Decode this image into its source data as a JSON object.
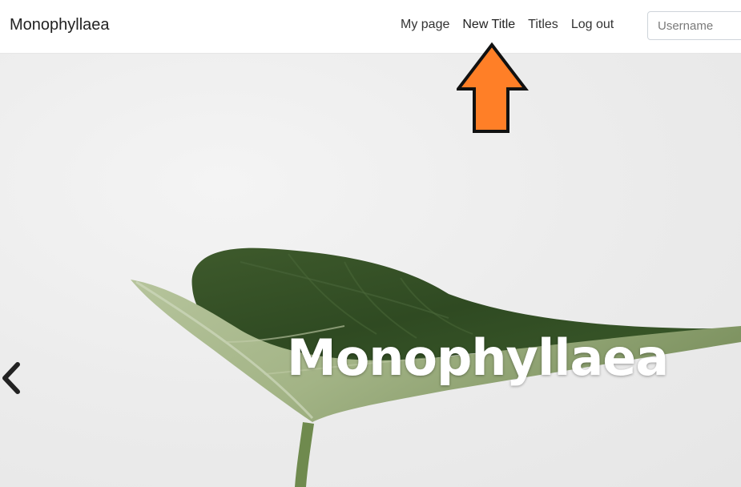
{
  "navbar": {
    "brand": "Monophyllaea",
    "links": [
      {
        "label": "My page"
      },
      {
        "label": "New Title"
      },
      {
        "label": "Titles"
      },
      {
        "label": "Log out"
      }
    ],
    "username_placeholder": "Username"
  },
  "hero": {
    "caption": "Monophyllaea",
    "prev_icon": "chevron-left-icon"
  },
  "annotation": {
    "icon": "up-arrow-icon",
    "color": "#FF7F27",
    "target": "New Title"
  }
}
